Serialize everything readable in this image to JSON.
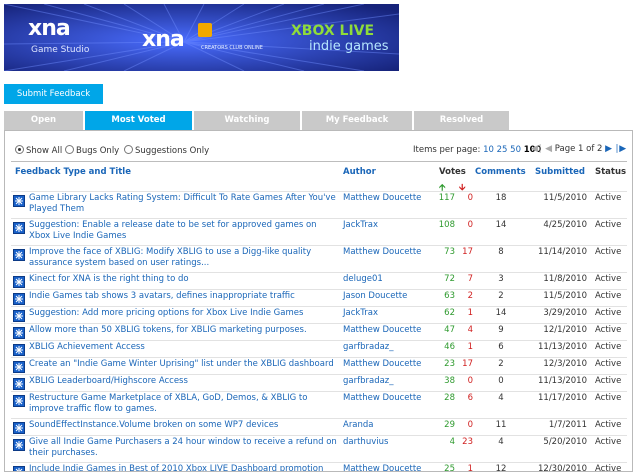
{
  "banner": {
    "logo_a": "xna",
    "logo_a_sub": "Game Studio",
    "logo_b": "xna",
    "logo_b_sub": "CREATORS CLUB ONLINE",
    "logo_c": "XBOX LIVE",
    "logo_c_sub": "indie games",
    "colors": {
      "background": "#1e2d8c",
      "green": "#8fdc3a"
    }
  },
  "submit_label": "Submit Feedback",
  "tabs": [
    {
      "label": "Open",
      "active": false
    },
    {
      "label": "Most Voted",
      "active": true
    },
    {
      "label": "Watching",
      "active": false
    },
    {
      "label": "My Feedback",
      "active": false
    },
    {
      "label": "Resolved",
      "active": false
    }
  ],
  "filters": [
    {
      "label": "Show All",
      "selected": true
    },
    {
      "label": "Bugs Only",
      "selected": false
    },
    {
      "label": "Suggestions Only",
      "selected": false
    }
  ],
  "per_page": {
    "label": "Items per page:",
    "options": [
      "10",
      "25",
      "50",
      "100"
    ],
    "current": "100"
  },
  "pager": {
    "text": "Page 1 of 2"
  },
  "columns": {
    "title": "Feedback Type and Title",
    "author": "Author",
    "votes": "Votes",
    "comments": "Comments",
    "submitted": "Submitted",
    "status": "Status"
  },
  "rows": [
    {
      "title": "Game Library Lacks Rating System: Difficult To Rate Games After You've Played Them",
      "author": "Matthew Doucette",
      "up": "117",
      "down": "0",
      "comments": "18",
      "submitted": "11/5/2010",
      "status": "Active"
    },
    {
      "title": "Suggestion: Enable a release date to be set for approved games on Xbox Live Indie Games",
      "author": "JackTrax",
      "up": "108",
      "down": "0",
      "comments": "14",
      "submitted": "4/25/2010",
      "status": "Active"
    },
    {
      "title": "Improve the face of XBLIG: Modify XBLIG to use a Digg-like quality assurance system based on user ratings...",
      "author": "Matthew Doucette",
      "up": "73",
      "down": "17",
      "comments": "8",
      "submitted": "11/14/2010",
      "status": "Active"
    },
    {
      "title": "Kinect for XNA is the right thing to do",
      "author": "deluge01",
      "up": "72",
      "down": "7",
      "comments": "3",
      "submitted": "11/8/2010",
      "status": "Active"
    },
    {
      "title": "Indie Games tab shows 3 avatars, defines inappropriate traffic",
      "author": "Jason Doucette",
      "up": "63",
      "down": "2",
      "comments": "2",
      "submitted": "11/5/2010",
      "status": "Active"
    },
    {
      "title": "Suggestion: Add more pricing options for Xbox Live Indie Games",
      "author": "JackTrax",
      "up": "62",
      "down": "1",
      "comments": "14",
      "submitted": "3/29/2010",
      "status": "Active"
    },
    {
      "title": "Allow more than 50 XBLIG tokens, for XBLIG marketing purposes.",
      "author": "Matthew Doucette",
      "up": "47",
      "down": "4",
      "comments": "9",
      "submitted": "12/1/2010",
      "status": "Active"
    },
    {
      "title": "XBLIG Achievement Access",
      "author": "garfbradaz_",
      "up": "46",
      "down": "1",
      "comments": "6",
      "submitted": "11/13/2010",
      "status": "Active"
    },
    {
      "title": "Create an \"Indie Game Winter Uprising\" list under the XBLIG dashboard",
      "author": "Matthew Doucette",
      "up": "23",
      "down": "17",
      "comments": "2",
      "submitted": "12/3/2010",
      "status": "Active"
    },
    {
      "title": "XBLIG Leaderboard/Highscore Access",
      "author": "garfbradaz_",
      "up": "38",
      "down": "0",
      "comments": "0",
      "submitted": "11/13/2010",
      "status": "Active"
    },
    {
      "title": "Restructure Game Marketplace of XBLA, GoD, Demos, & XBLIG to improve traffic flow to games.",
      "author": "Matthew Doucette",
      "up": "28",
      "down": "6",
      "comments": "4",
      "submitted": "11/17/2010",
      "status": "Active"
    },
    {
      "title": "SoundEffectInstance.Volume broken on some WP7 devices",
      "author": "Aranda",
      "up": "29",
      "down": "0",
      "comments": "11",
      "submitted": "1/7/2011",
      "status": "Active"
    },
    {
      "title": "Give all Indie Game Purchasers a 24 hour window to receive a refund on their purchases.",
      "author": "darthuvius",
      "up": "4",
      "down": "23",
      "comments": "4",
      "submitted": "5/20/2010",
      "status": "Active"
    },
    {
      "title": "Include Indie Games in Best of 2010 Xbox LIVE Dashboard promotion",
      "author": "Matthew Doucette",
      "up": "25",
      "down": "1",
      "comments": "12",
      "submitted": "12/30/2010",
      "status": "Active"
    }
  ]
}
